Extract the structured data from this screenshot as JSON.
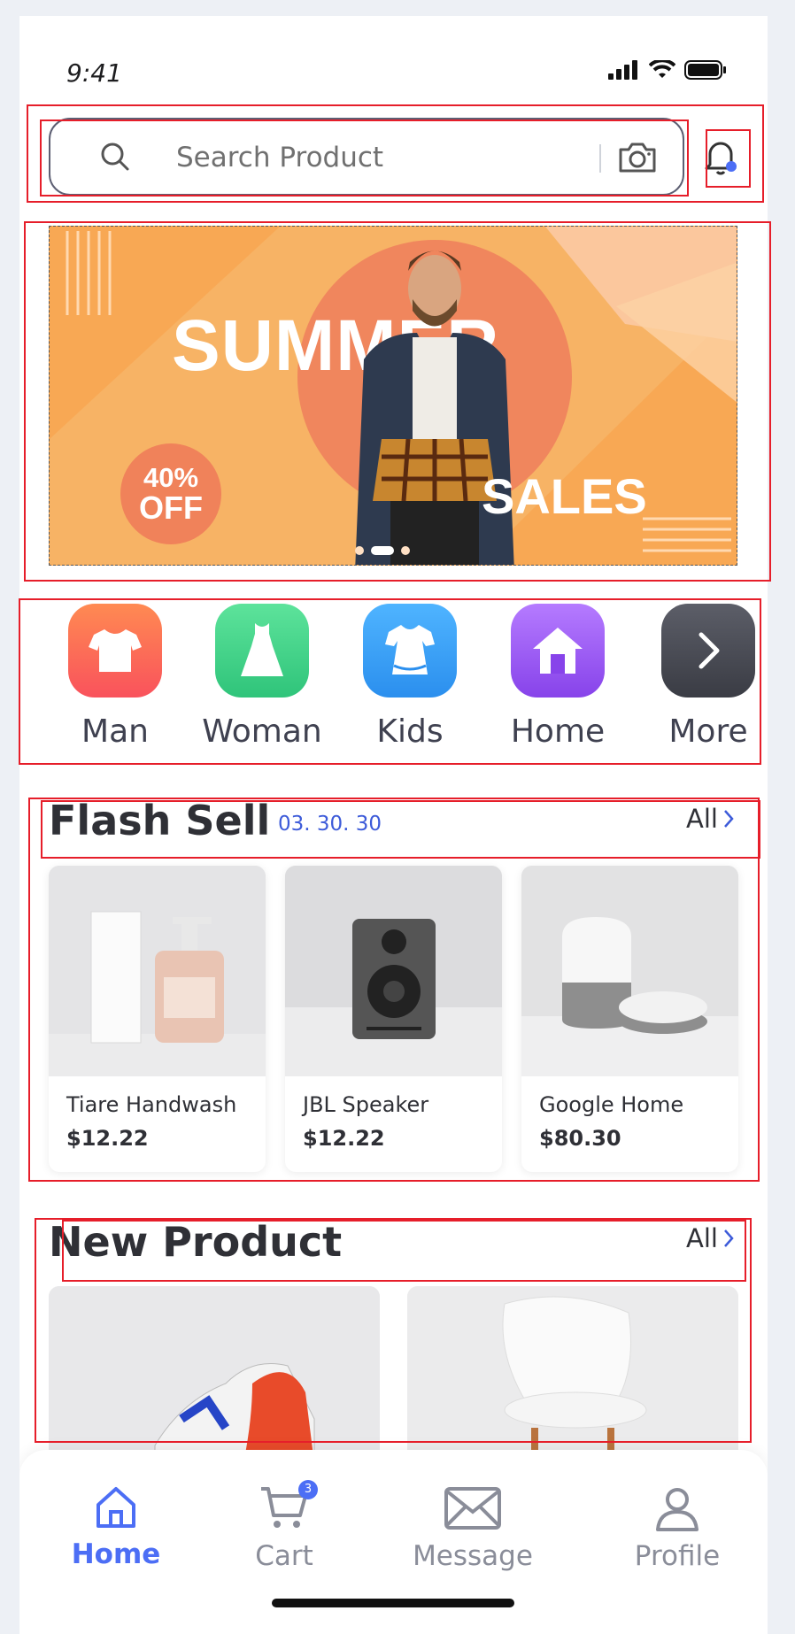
{
  "status": {
    "time": "9:41"
  },
  "search": {
    "placeholder": "Search Product"
  },
  "banner": {
    "title": "SUMMER",
    "subtitle": "SALES",
    "discount_pct": "40%",
    "discount_off": "OFF",
    "slide_count": 3,
    "active_slide": 2
  },
  "categories": [
    {
      "label": "Man",
      "icon": "tshirt-icon",
      "color": "#f96a4a"
    },
    {
      "label": "Woman",
      "icon": "dress-icon",
      "color": "#3fcf82"
    },
    {
      "label": "Kids",
      "icon": "kids-dress-icon",
      "color": "#3b9ff5"
    },
    {
      "label": "Home",
      "icon": "house-icon",
      "color": "#9a5cf0"
    },
    {
      "label": "More",
      "icon": "chevron-right-icon",
      "color": "#4a4c55"
    }
  ],
  "flash_sell": {
    "title": "Flash Sell",
    "timer": "03. 30. 30",
    "all_label": "All",
    "items": [
      {
        "name": "Tiare Handwash",
        "price": "$12.22"
      },
      {
        "name": "JBL Speaker",
        "price": "$12.22"
      },
      {
        "name": "Google Home",
        "price": "$80.30"
      }
    ]
  },
  "new_product": {
    "title": "New Product",
    "all_label": "All"
  },
  "nav": {
    "items": [
      {
        "label": "Home",
        "icon": "home-icon"
      },
      {
        "label": "Cart",
        "icon": "cart-icon",
        "badge": "3"
      },
      {
        "label": "Message",
        "icon": "mail-icon"
      },
      {
        "label": "Profile",
        "icon": "user-icon"
      }
    ]
  },
  "colors": {
    "accent": "#4c6ef5",
    "banner_bg": "#f8a854"
  }
}
